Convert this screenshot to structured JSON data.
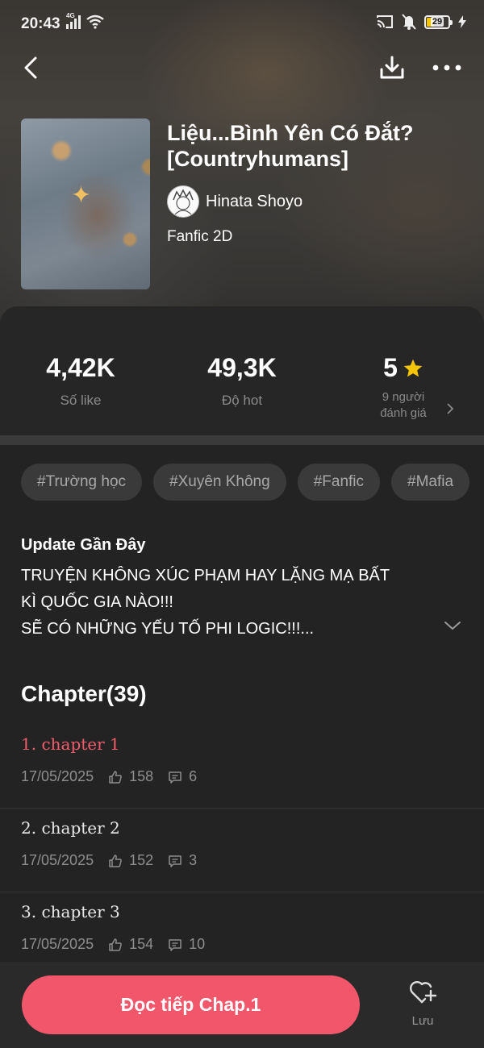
{
  "status_bar": {
    "time": "20:43",
    "network": "4G",
    "battery": "29"
  },
  "book": {
    "title": "Liệu...Bình Yên Có Đắt? [Countryhumans]",
    "author": "Hinata Shoyo",
    "category": "Fanfic 2D"
  },
  "stats": {
    "likes_value": "4,42K",
    "likes_label": "Số like",
    "hot_value": "49,3K",
    "hot_label": "Độ hot",
    "rating_value": "5",
    "rating_label_line1": "9 người",
    "rating_label_line2": "đánh giá"
  },
  "tags": [
    "#Trường học",
    "#Xuyên Không",
    "#Fanfic",
    "#Mafia"
  ],
  "update": {
    "heading": "Update Gần Đây",
    "line1": "TRUYỆN KHÔNG XÚC PHẠM HAY LẶNG MẠ BẤT",
    "line2": "KÌ QUỐC GIA NÀO!!!",
    "line3": "SẼ CÓ NHỮNG YẾU TỐ PHI LOGIC!!!..."
  },
  "chapters_heading": "Chapter(39)",
  "chapters": [
    {
      "title": "1. chapter 1",
      "date": "17/05/2025",
      "likes": "158",
      "comments": "6"
    },
    {
      "title": "2. chapter 2",
      "date": "17/05/2025",
      "likes": "152",
      "comments": "3"
    },
    {
      "title": "3. chapter 3",
      "date": "17/05/2025",
      "likes": "154",
      "comments": "10"
    }
  ],
  "bottom": {
    "read_label": "Đọc tiếp Chap.1",
    "save_label": "Lưu"
  },
  "colors": {
    "accent": "#f2566b",
    "star": "#f5c400",
    "background": "#232323"
  }
}
